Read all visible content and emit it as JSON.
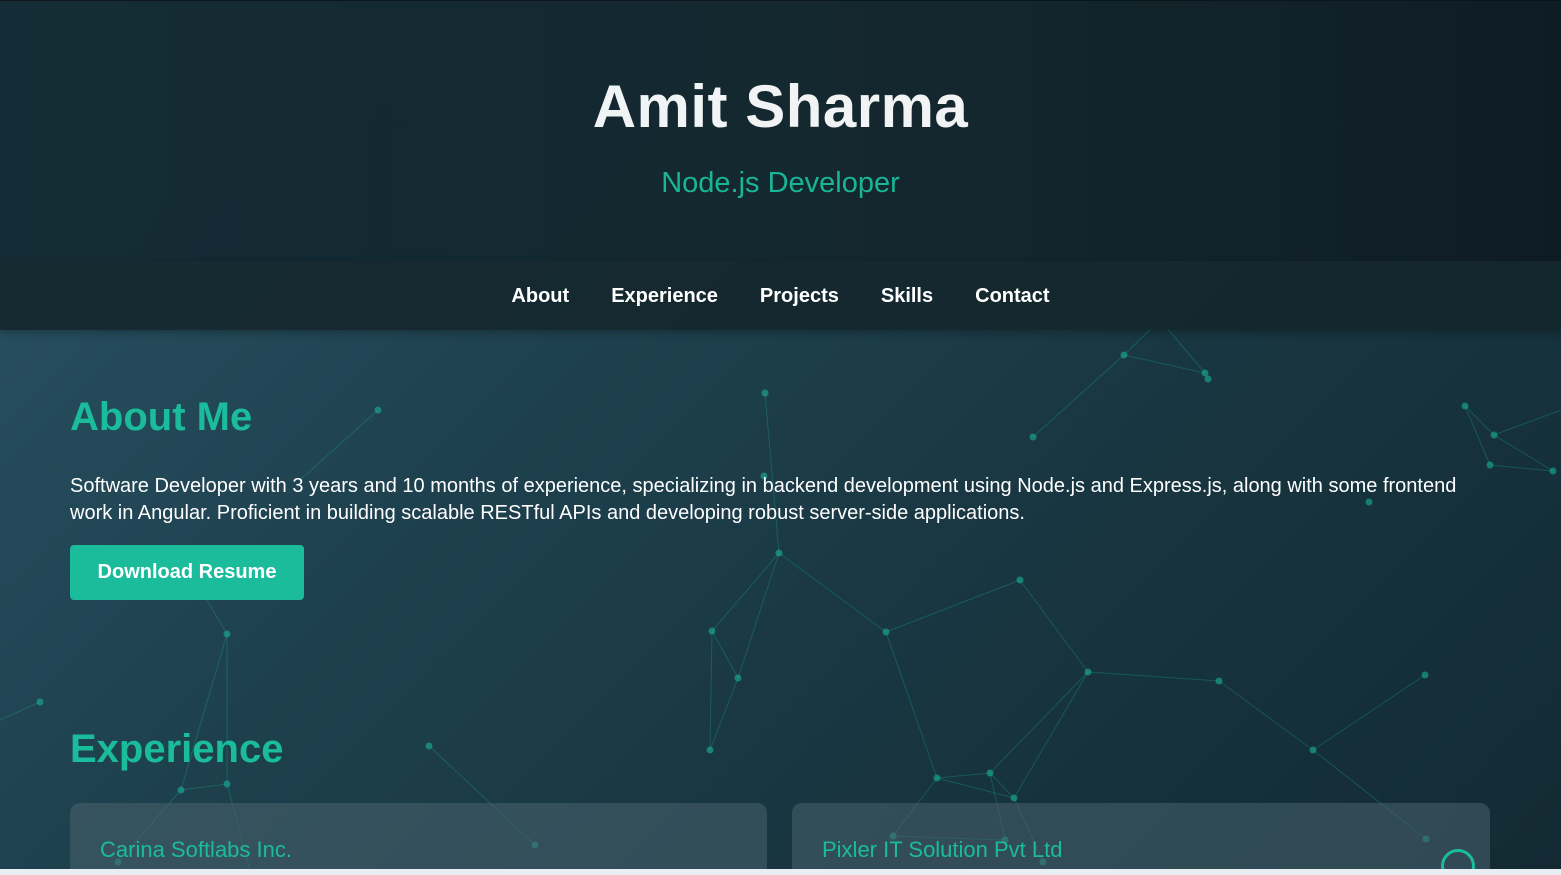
{
  "header": {
    "name": "Amit Sharma",
    "role": "Node.js Developer"
  },
  "nav": {
    "items": [
      "About",
      "Experience",
      "Projects",
      "Skills",
      "Contact"
    ]
  },
  "about": {
    "title": "About Me",
    "text": "Software Developer with 3 years and 10 months of experience, specializing in backend development using Node.js and Express.js, along with some frontend work in Angular. Proficient in building scalable RESTful APIs and developing robust server-side applications.",
    "button_label": "Download Resume"
  },
  "experience": {
    "title": "Experience",
    "companies": [
      "Carina Softlabs Inc.",
      "Pixler IT Solution Pvt Ltd"
    ]
  },
  "colors": {
    "accent": "#1abc9c",
    "background": "#1f4250",
    "header": "#132a33"
  }
}
